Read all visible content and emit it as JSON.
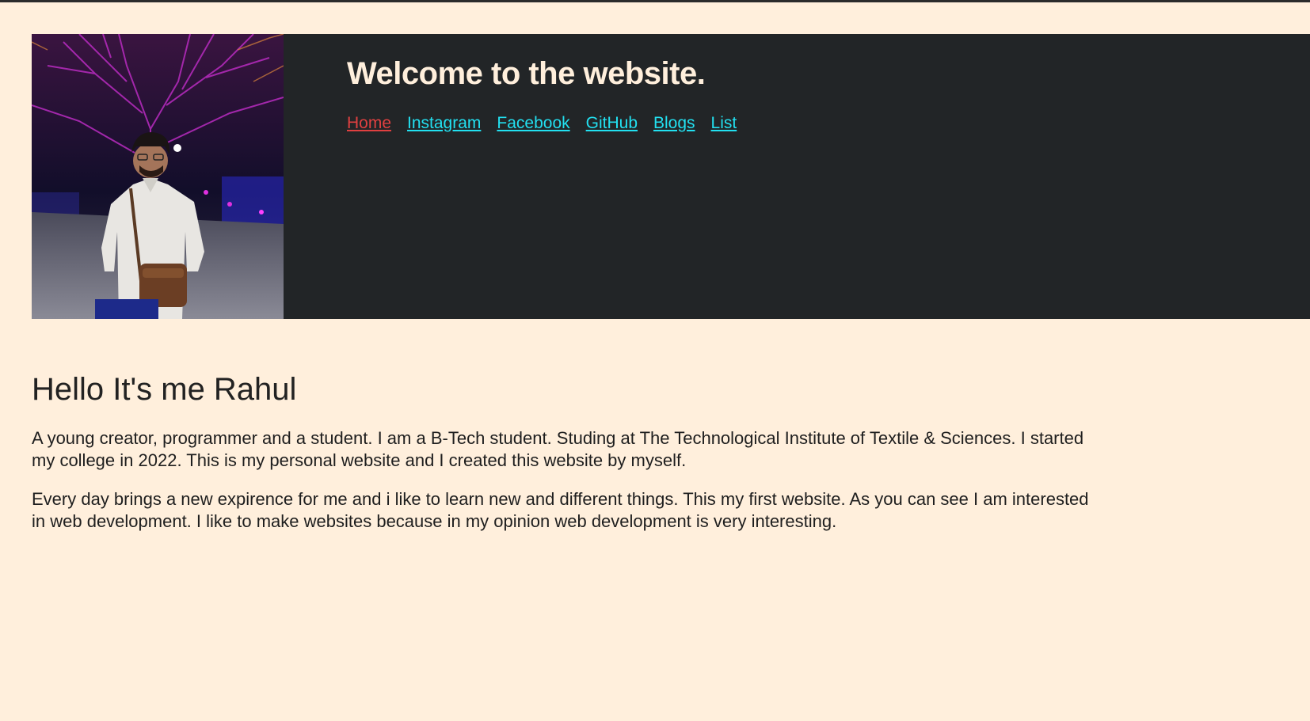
{
  "colors": {
    "page_background": "#FFEFDC",
    "header_background": "#222527",
    "title_color": "#FFEFDC",
    "nav_active": "#E04040",
    "nav_link": "#22E0F0",
    "text": "#222222"
  },
  "header": {
    "photo_icon": "profile-photo",
    "title": "Welcome to the website.",
    "nav": [
      {
        "label": "Home",
        "active": true
      },
      {
        "label": "Instagram",
        "active": false
      },
      {
        "label": "Facebook",
        "active": false
      },
      {
        "label": "GitHub",
        "active": false
      },
      {
        "label": "Blogs",
        "active": false
      },
      {
        "label": "List",
        "active": false
      }
    ]
  },
  "main": {
    "heading": "Hello It's me Rahul",
    "paragraphs": [
      "A young creator, programmer and a student. I am a B-Tech student. Studing at The Technological Institute of Textile & Sciences. I started my college in 2022. This is my personal website and I created this website by myself.",
      "Every day brings a new expirence for me and i like to learn new and different things. This my first website. As you can see I am interested in web development. I like to make websites because in my opinion web development is very interesting."
    ]
  }
}
